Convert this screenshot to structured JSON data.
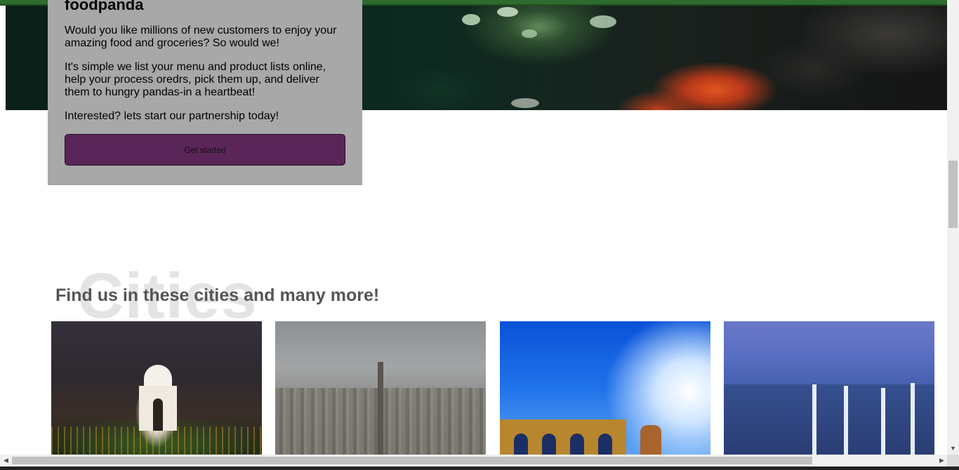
{
  "promo": {
    "title": "foodpanda",
    "paragraph1": "Would you like millions of new customers to enjoy your amazing food and groceries? So would we!",
    "paragraph2": "It's simple we list your menu and product lists online, help your process oredrs, pick them up, and deliver them to hungry pandas-in a heartbeat!",
    "paragraph3": "Interested? lets start our partnership today!",
    "button_label": "Get started"
  },
  "cities": {
    "watermark": "Cities",
    "heading": "Find us in these cities and many more!"
  },
  "scrollbars": {
    "left_arrow": "◀",
    "right_arrow": "▶",
    "down_arrow": "▼"
  },
  "colors": {
    "topbar": "#2e6b2e",
    "card_bg": "#a8a8a8",
    "button_bg": "#5a2558",
    "heading": "#555555"
  },
  "icons": [
    "scroll-left-arrow-icon",
    "scroll-right-arrow-icon",
    "scroll-down-arrow-icon"
  ]
}
